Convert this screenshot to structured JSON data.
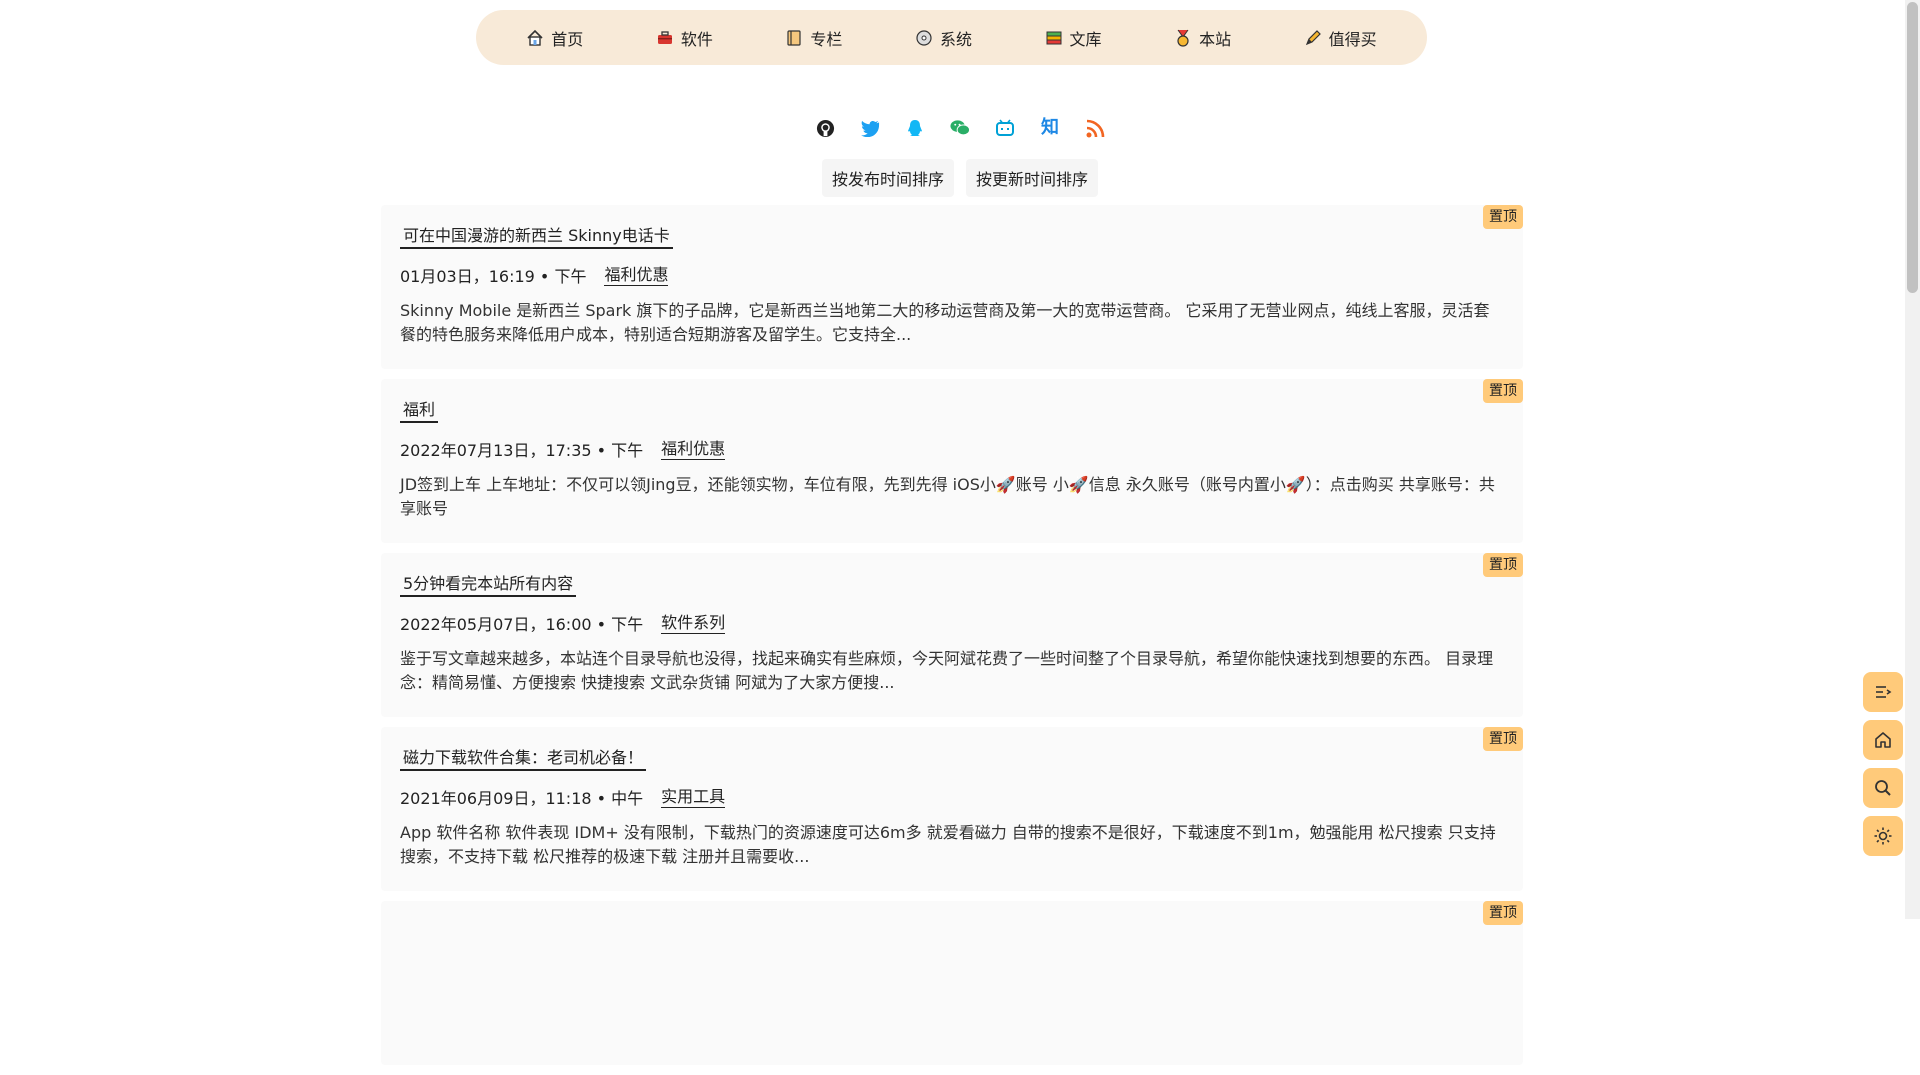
{
  "nav": {
    "items": [
      {
        "label": "首页",
        "icon": "house-icon"
      },
      {
        "label": "软件",
        "icon": "toolbox-icon"
      },
      {
        "label": "专栏",
        "icon": "notebook-icon"
      },
      {
        "label": "系统",
        "icon": "disc-icon"
      },
      {
        "label": "文库",
        "icon": "books-icon"
      },
      {
        "label": "本站",
        "icon": "medal-icon"
      },
      {
        "label": "值得买",
        "icon": "pen-icon"
      }
    ]
  },
  "social": {
    "icons": [
      "github-icon",
      "twitter-icon",
      "qq-icon",
      "wechat-icon",
      "bilibili-icon",
      "zhihu-icon",
      "rss-icon"
    ],
    "zhihu_text": "知"
  },
  "sort": {
    "by_published": "按发布时间排序",
    "by_updated": "按更新时间排序"
  },
  "posts": [
    {
      "badge": "置顶",
      "title": "可在中国漫游的新西兰 Skinny电话卡",
      "date": "01月03日，16:19 • 下午",
      "category": "福利优惠",
      "excerpt": "Skinny Mobile 是新西兰 Spark 旗下的子品牌，它是新西兰当地第二大的移动运营商及第一大的宽带运营商。 它采用了无营业网点，纯线上客服，灵活套餐的特色服务来降低用户成本，特别适合短期游客及留学生。它支持全..."
    },
    {
      "badge": "置顶",
      "title": "福利",
      "date": "2022年07月13日，17:35 • 下午",
      "category": "福利优惠",
      "excerpt": "JD签到上车 上车地址：不仅可以领Jing豆，还能领实物，车位有限，先到先得 iOS小🚀账号 小🚀信息 永久账号（账号内置小🚀）：点击购买 共享账号：共享账号"
    },
    {
      "badge": "置顶",
      "title": "5分钟看完本站所有内容",
      "date": "2022年05月07日，16:00 • 下午",
      "category": "软件系列",
      "excerpt": "鉴于写文章越来越多，本站连个目录导航也没得，找起来确实有些麻烦，今天阿斌花费了一些时间整了个目录导航，希望你能快速找到想要的东西。 目录理念：精简易懂、方便搜索 快捷搜索 文武杂货铺 阿斌为了大家方便搜..."
    },
    {
      "badge": "置顶",
      "title": "磁力下载软件合集：老司机必备！",
      "date": "2021年06月09日，11:18 • 中午",
      "category": "实用工具",
      "excerpt": "App 软件名称 软件表现 IDM+ 没有限制，下载热门的资源速度可达6m多 就爱看磁力 自带的搜索不是很好，下载速度不到1m，勉强能用 松尺搜索 只支持搜索，不支持下载 松尺推荐的极速下载 注册并且需要收..."
    },
    {
      "badge": "置顶",
      "title": "",
      "date": "",
      "category": "",
      "excerpt": ""
    }
  ],
  "floating": {
    "buttons": [
      "toc-icon",
      "home-icon",
      "search-icon",
      "theme-sun-icon"
    ]
  }
}
